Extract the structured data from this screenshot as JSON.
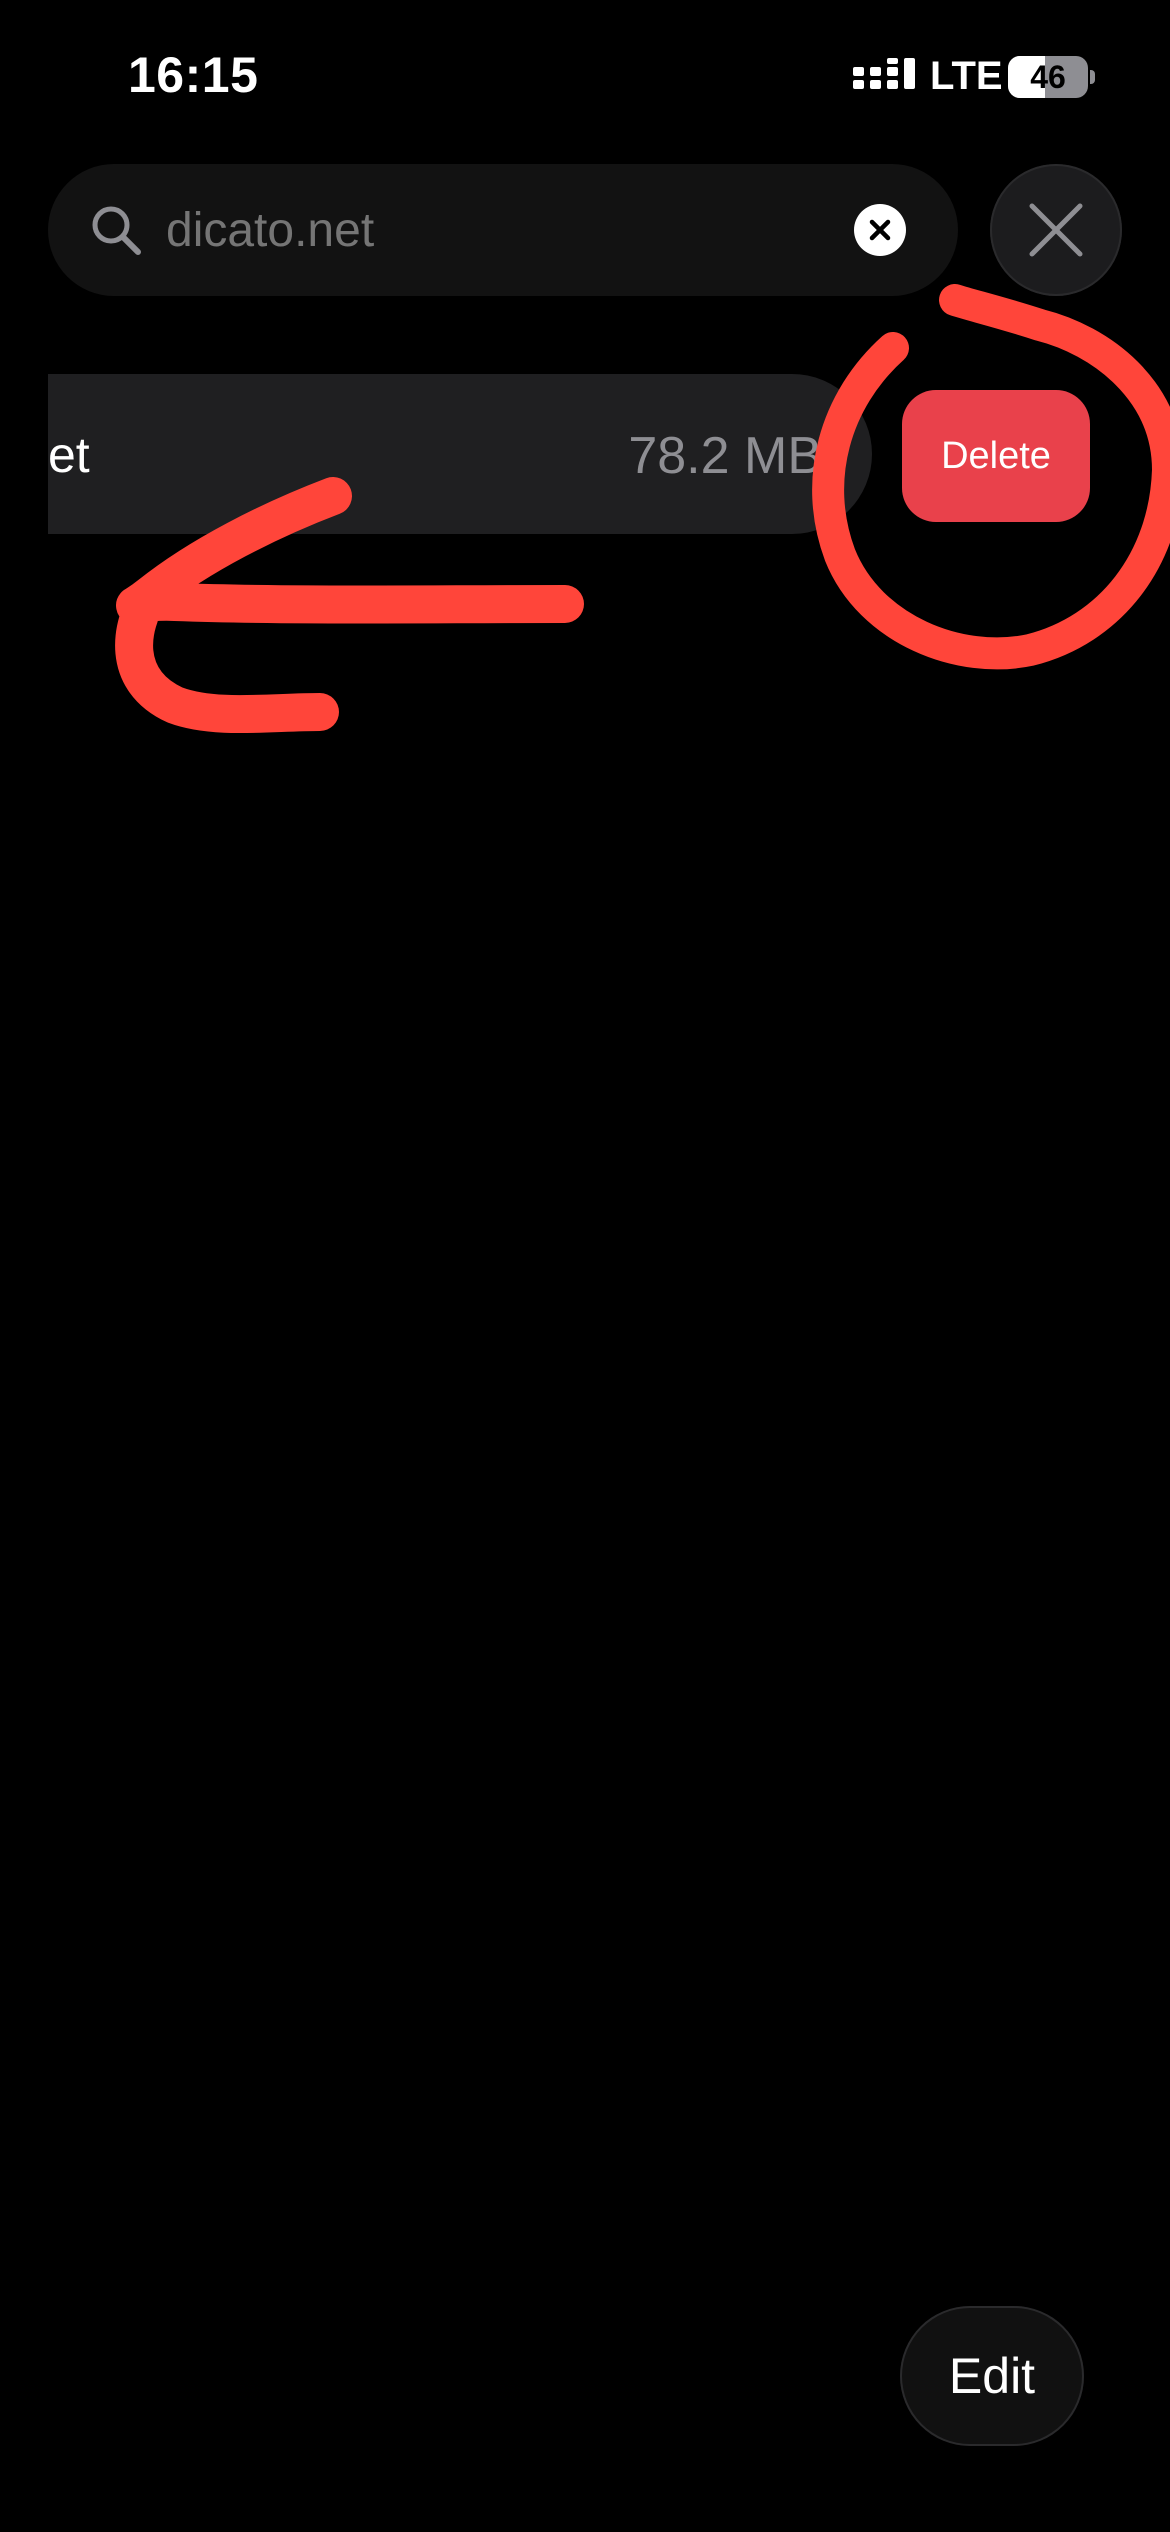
{
  "status_bar": {
    "time": "16:15",
    "network": "LTE",
    "battery": "46",
    "battery_level": 0.46
  },
  "search": {
    "value": "",
    "placeholder": "dicato.net"
  },
  "results": [
    {
      "name_visible": "et",
      "size": "78.2 MB"
    }
  ],
  "swipe_action": {
    "delete_label": "Delete"
  },
  "footer": {
    "edit_label": "Edit"
  },
  "colors": {
    "background": "#000000",
    "delete": "#e9414b",
    "annotation": "#ff453a"
  },
  "icons": {
    "search": "search-icon",
    "clear": "clear-circle-icon",
    "close": "close-icon",
    "signal": "signal-icon",
    "battery": "battery-icon"
  }
}
